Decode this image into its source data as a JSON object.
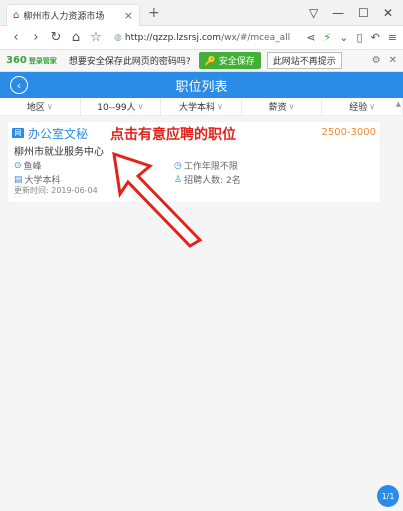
{
  "browser": {
    "tab_title": "柳州市人力资源市场",
    "favicon": "house-icon",
    "new_tab": "+",
    "window_controls": [
      "menu",
      "minimize",
      "maximize",
      "close"
    ],
    "address": {
      "prefix": "http://",
      "domain": "qzzp.lzsrsj.com",
      "path": "/wx/#/mcea_all"
    }
  },
  "password_bar": {
    "brand": "360",
    "brand_sub": "登录管家",
    "message": "想要安全保存此网页的密码吗?",
    "save_label": "安全保存",
    "no_prompt_label": "此网站不再提示"
  },
  "app": {
    "title": "职位列表",
    "filters": [
      "地区",
      "10--99人",
      "大学本科",
      "薪资",
      "经验"
    ]
  },
  "job": {
    "badge": "网",
    "title": "办公室文秘",
    "salary": "2500-3000",
    "company": "柳州市就业服务中心",
    "location": "鱼峰",
    "experience": "工作年限不限",
    "education": "大学本科",
    "recruit_count": "招聘人数: 2名",
    "updated": "更新时间: 2019-06-04"
  },
  "annotation": {
    "text": "点击有意应聘的职位",
    "color": "#e0241c"
  },
  "pager": "1/1",
  "colors": {
    "accent": "#2b8ce8",
    "salary": "#f08a35",
    "save_green": "#42b037"
  }
}
